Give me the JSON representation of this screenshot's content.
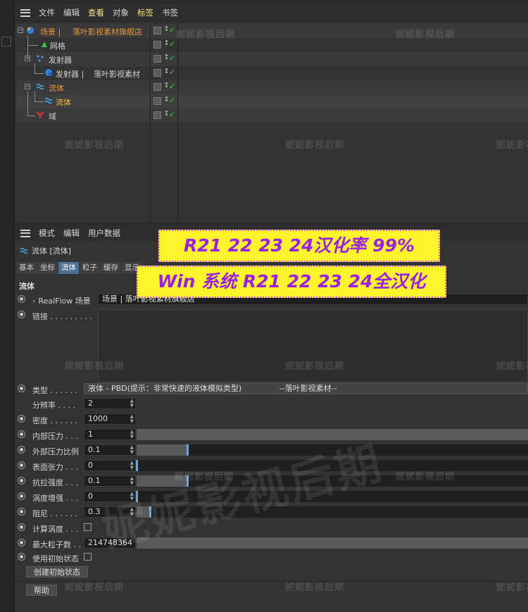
{
  "object_manager": {
    "menu": [
      "文件",
      "编辑",
      "查看",
      "对象",
      "标签",
      "书签"
    ],
    "active_menu_index": 4,
    "objects": [
      {
        "name": "场景 |",
        "extra": "落叶影视素材旗舰店",
        "color": "#e8963a",
        "icon": "realflow-scene-icon"
      },
      {
        "name": "网格",
        "extra": "",
        "color": "#d0d0d0",
        "icon": "mesh-icon"
      },
      {
        "name": "发射器",
        "extra": "",
        "color": "#d0d0d0",
        "icon": "emitter-group-icon"
      },
      {
        "name": "发射器 |",
        "extra": "落叶影视素材",
        "color": "#d0d0d0",
        "icon": "emitter-icon"
      },
      {
        "name": "流体",
        "extra": "",
        "color": "#e8963a",
        "icon": "fluid-group-icon"
      },
      {
        "name": "流体",
        "extra": "",
        "color": "#f0c040",
        "icon": "fluid-icon"
      },
      {
        "name": "域",
        "extra": "",
        "color": "#d0d0d0",
        "icon": "domain-icon"
      }
    ],
    "check_mark": "✓"
  },
  "attribute_manager": {
    "menu": [
      "模式",
      "编辑",
      "用户数据"
    ],
    "title": "流体 [流体]",
    "tabs": [
      "基本",
      "坐标",
      "流体",
      "粒子",
      "缓存",
      "显示"
    ],
    "active_tab_index": 2,
    "section": "流体",
    "realflow_label": "RealFlow 场景",
    "realflow_value": "场景 |     落叶影视素材旗舰店",
    "link_label": "链接 . . . . . . . . .",
    "type_label": "类型 . . . . . .",
    "type_value": "液体 - PBD(提示：非常快速的液体模拟类型)",
    "type_suffix": "--落叶影视素材--",
    "params": [
      {
        "label": "分辨率 . . . .",
        "value": "2"
      },
      {
        "label": "密度 . . . . . .",
        "value": "1000"
      },
      {
        "label": "内部压力 . . .",
        "value": "1",
        "level": 1.0
      },
      {
        "label": "外部压力比例",
        "value": "0.1",
        "level": 0.13
      },
      {
        "label": "表面张力 . . .",
        "value": "0",
        "level": 0.0
      },
      {
        "label": "抗拉强度 . . .",
        "value": "0.1",
        "level": 0.13
      },
      {
        "label": "涡度增强 . . .",
        "value": "0",
        "level": 0.0
      },
      {
        "label": "阻尼 . . . . . .",
        "value": "0.3",
        "level": 0.035
      }
    ],
    "vorticity_label": "计算涡度 . . .",
    "max_particles_label": "最大粒子数 . .",
    "max_particles_value": "214748364",
    "use_initial_label": "使用初始状态",
    "create_initial_button": "创建初始状态",
    "help_button": "帮助"
  },
  "watermark": "妮妮影视后期",
  "banner": {
    "line1": "R21 22 23 24汉化率 99%",
    "line2": "Win 系统 R21 22 23 24全汉化"
  }
}
